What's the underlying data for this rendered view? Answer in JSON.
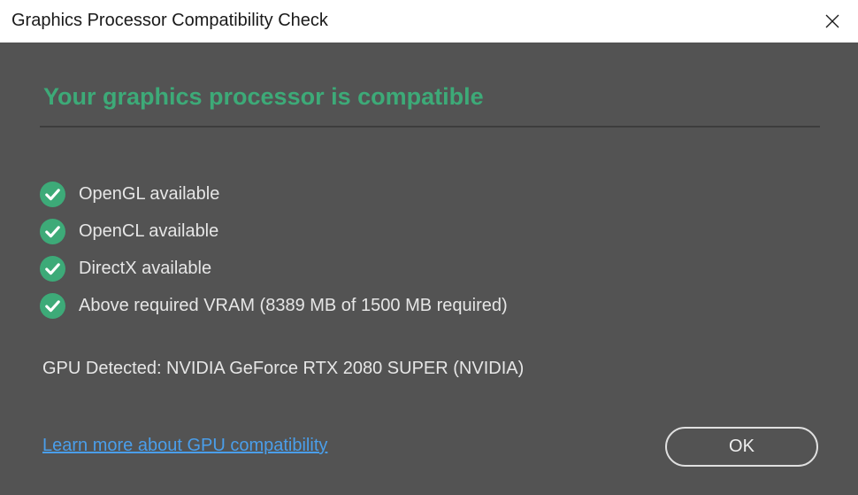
{
  "window": {
    "title": "Graphics Processor Compatibility Check"
  },
  "main": {
    "heading": "Your graphics processor is compatible",
    "checks": [
      {
        "label": "OpenGL available",
        "icon": "check-circle-icon",
        "status": "pass"
      },
      {
        "label": "OpenCL available",
        "icon": "check-circle-icon",
        "status": "pass"
      },
      {
        "label": "DirectX available",
        "icon": "check-circle-icon",
        "status": "pass"
      },
      {
        "label": "Above required VRAM (8389 MB of 1500 MB required)",
        "icon": "check-circle-icon",
        "status": "pass"
      }
    ],
    "gpu_detected": "GPU Detected: NVIDIA GeForce RTX 2080 SUPER (NVIDIA)",
    "learn_more_link": "Learn more about GPU compatibility",
    "ok_label": "OK"
  },
  "colors": {
    "background": "#535353",
    "accent_green": "#3daa78",
    "link_blue": "#4a9eea",
    "text": "#e6e6e6"
  }
}
